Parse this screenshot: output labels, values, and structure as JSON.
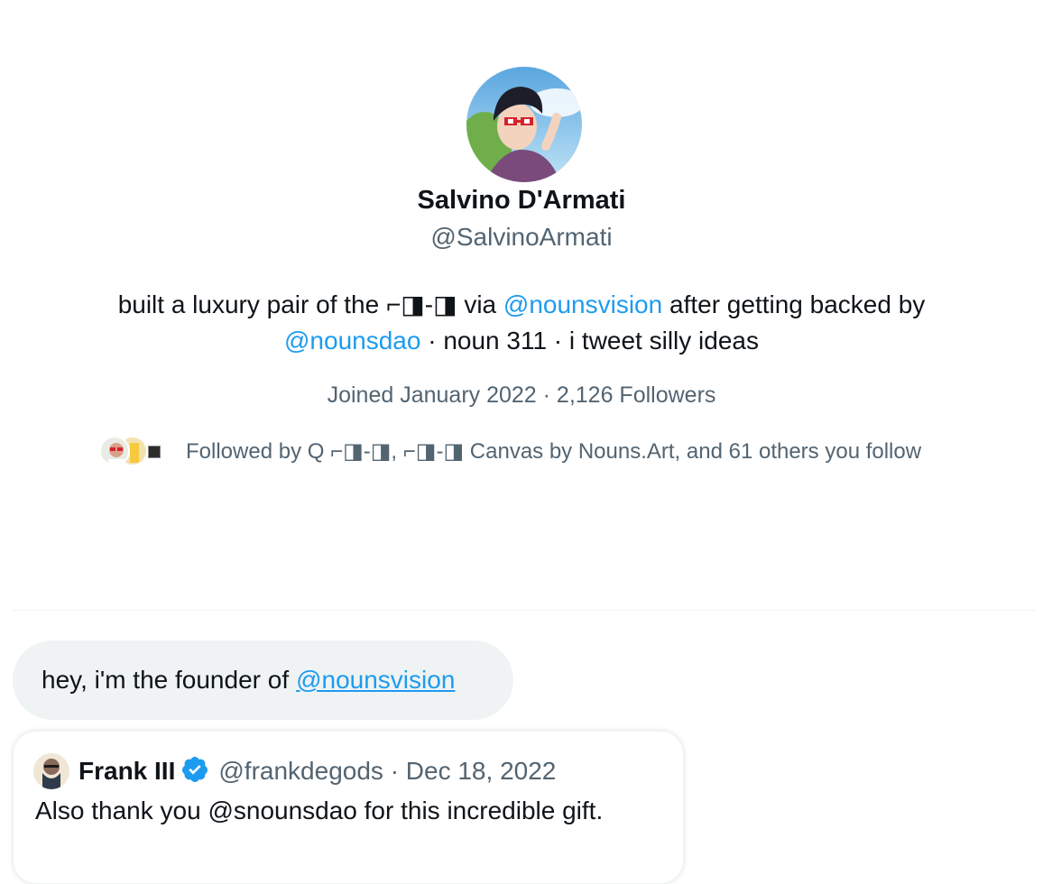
{
  "profile": {
    "name": "Salvino D'Armati",
    "handle": "@SalvinoArmati",
    "bio": {
      "part1": "built a luxury pair of the ⌐◨-◨ via ",
      "mention1": "@nounsvision",
      "part2": " after getting backed by",
      "mention2": "@nounsdao",
      "part3": " · noun 311 · i tweet silly ideas"
    },
    "meta": "Joined January 2022 · 2,126 Followers",
    "followed_by": "Followed by Q ⌐◨-◨, ⌐◨-◨ Canvas by Nouns.Art, and 61 others you follow"
  },
  "message": {
    "text": "hey, i'm the founder of",
    "mention": "@nounsvision"
  },
  "quoted_tweet": {
    "author_name": "Frank III",
    "author_handle": "@frankdegods · Dec 18, 2022",
    "text": "Also thank you @snounsdao for this incredible gift.",
    "verified_icon": "verified-badge-icon"
  },
  "colors": {
    "link": "#1d9bf0",
    "secondary_text": "#536471",
    "bubble_bg": "#eff3f4"
  }
}
